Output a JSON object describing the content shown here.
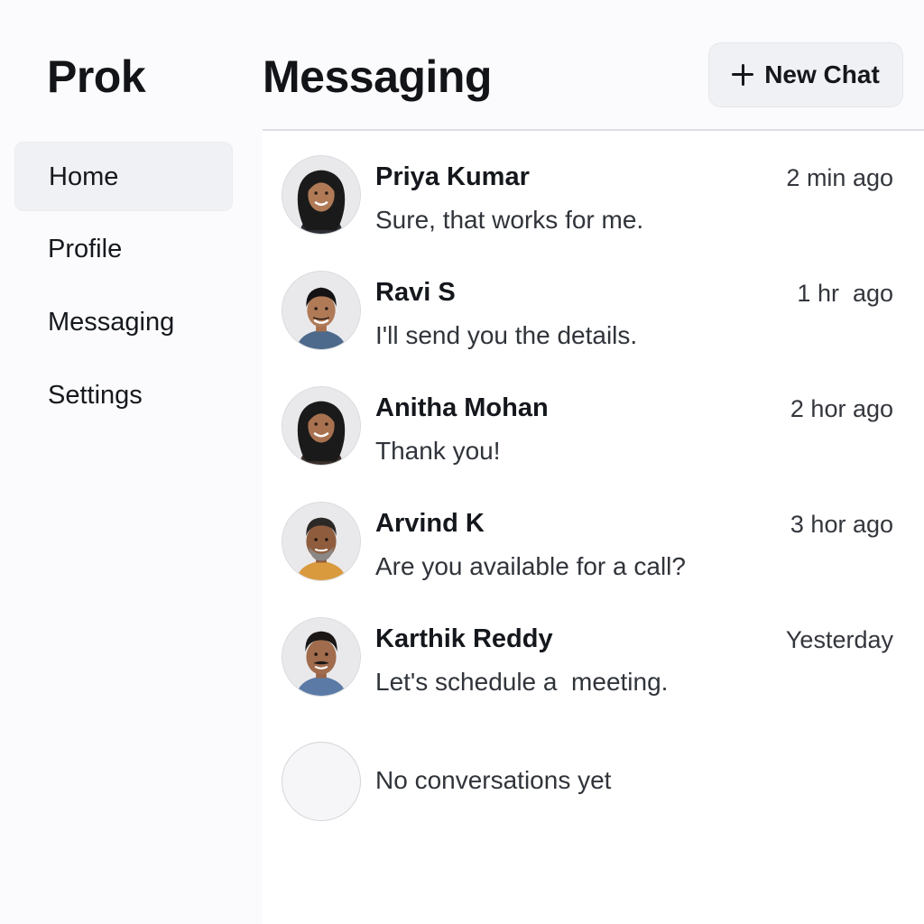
{
  "app": {
    "logo": "Prok"
  },
  "sidebar": {
    "items": [
      {
        "label": "Home",
        "active": true
      },
      {
        "label": "Profile",
        "active": false
      },
      {
        "label": "Messaging",
        "active": false
      },
      {
        "label": "Settings",
        "active": false
      }
    ]
  },
  "header": {
    "title": "Messaging",
    "new_chat_label": "New Chat",
    "new_chat_icon": "plus-icon"
  },
  "conversations": [
    {
      "name": "Priya Kumar",
      "time": "2 min ago",
      "preview": "Sure, that works for me.",
      "avatar": "woman-avatar"
    },
    {
      "name": "Ravi S",
      "time": "1 hr  ago",
      "preview": "I'll send you the details.",
      "avatar": "man-avatar"
    },
    {
      "name": "Anitha Mohan",
      "time": "2 hor ago",
      "preview": "Thank you!",
      "avatar": "woman-avatar"
    },
    {
      "name": "Arvind K",
      "time": "3 hor ago",
      "preview": "Are you available for a call?",
      "avatar": "bearded-man-avatar"
    },
    {
      "name": "Karthik Reddy",
      "time": "Yesterday",
      "preview": "Let's schedule a  meeting.",
      "avatar": "man-mustache-avatar"
    }
  ],
  "empty_state": {
    "text": "No conversations yet"
  },
  "colors": {
    "background": "#fbfbfd",
    "panel": "#ffffff",
    "active_nav": "#f0f1f4",
    "divider": "#dcdde1",
    "text_primary": "#14171c",
    "text_secondary": "#30343a"
  }
}
